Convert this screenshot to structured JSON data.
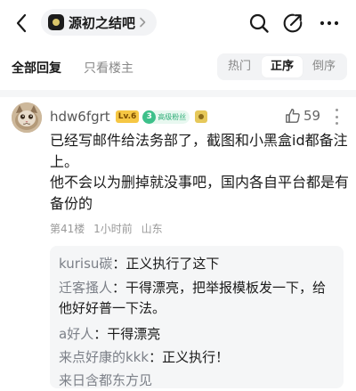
{
  "header": {
    "forum_name": "源初之结吧"
  },
  "filters": {
    "all_replies": "全部回复",
    "only_op": "只看楼主",
    "sort_options": [
      "热门",
      "正序",
      "倒序"
    ],
    "selected_sort": "正序"
  },
  "post": {
    "username": "hdw6fgrt",
    "level_badge": "Lv.6",
    "fan_level": "3",
    "fan_badge": "高级粉丝",
    "likes": "59",
    "content": [
      "已经写邮件给法务部了，截图和小黑盒id都备注上。",
      "他不会以为删掉就没事吧，国内各自平台都是有备份的"
    ],
    "floor": "第41楼",
    "time": "1小时前",
    "location": "山东"
  },
  "replies": [
    {
      "author": "kurisu碳",
      "text": "：正义执行了这下"
    },
    {
      "author": "迁客搔人",
      "text": "：干得漂亮，把举报模板发一下，给他好好普一下法。"
    },
    {
      "author": "a好人",
      "text": "：干得漂亮"
    },
    {
      "author": "来点好康的kkk",
      "text": "：正义执行！"
    },
    {
      "author": "来日含都东方见",
      "text": ""
    }
  ],
  "colors": {
    "accent_green": "#3dc08a",
    "level_gold": "#f6c744",
    "muted_text": "#999999",
    "reply_author": "#7c8088"
  }
}
